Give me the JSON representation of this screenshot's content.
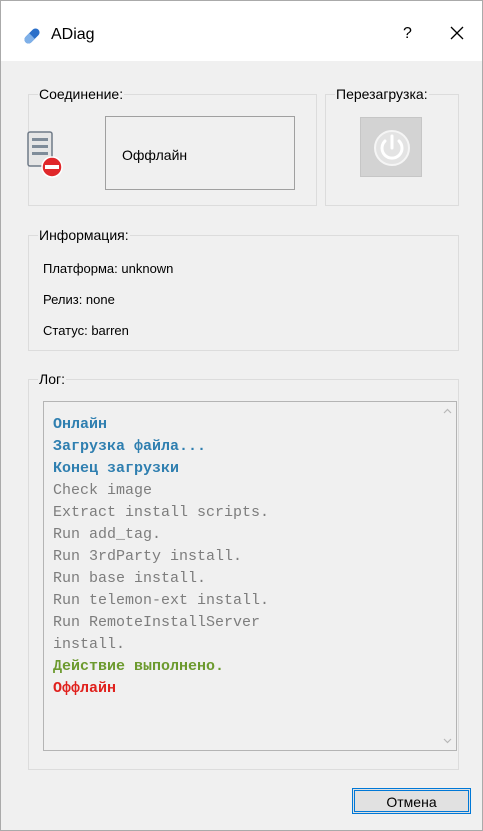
{
  "window": {
    "title": "ADiag",
    "help_label": "?",
    "icons": {
      "app": "pill-icon",
      "close": "close-icon"
    }
  },
  "connection": {
    "label": "Соединение:",
    "status": "Оффлайн",
    "icon": "server-offline-icon"
  },
  "reboot": {
    "label": "Перезагрузка:",
    "icon": "power-icon"
  },
  "info": {
    "label": "Информация:",
    "lines": [
      "Платформа: unknown",
      "Релиз: none",
      "Статус: barren"
    ]
  },
  "log": {
    "label": "Лог:",
    "lines": [
      {
        "text": "Онлайн",
        "color": "#2f7fb0",
        "bold": true
      },
      {
        "text": "Загрузка файла...",
        "color": "#2f7fb0",
        "bold": true
      },
      {
        "text": "Конец загрузки",
        "color": "#2f7fb0",
        "bold": true
      },
      {
        "text": "Check image",
        "color": "#7d7d7d",
        "bold": false
      },
      {
        "text": "Extract install scripts.",
        "color": "#7d7d7d",
        "bold": false
      },
      {
        "text": "Run add_tag.",
        "color": "#7d7d7d",
        "bold": false
      },
      {
        "text": "Run 3rdParty install.",
        "color": "#7d7d7d",
        "bold": false
      },
      {
        "text": "Run base install.",
        "color": "#7d7d7d",
        "bold": false
      },
      {
        "text": "Run telemon-ext install.",
        "color": "#7d7d7d",
        "bold": false
      },
      {
        "text": "Run RemoteInstallServer",
        "color": "#7d7d7d",
        "bold": false
      },
      {
        "text": "install.",
        "color": "#7d7d7d",
        "bold": false
      },
      {
        "text": "Действие выполнено.",
        "color": "#6c9a2e",
        "bold": true
      },
      {
        "text": "Оффлайн",
        "color": "#e0211d",
        "bold": true
      }
    ]
  },
  "cancel_label": "Отмена"
}
